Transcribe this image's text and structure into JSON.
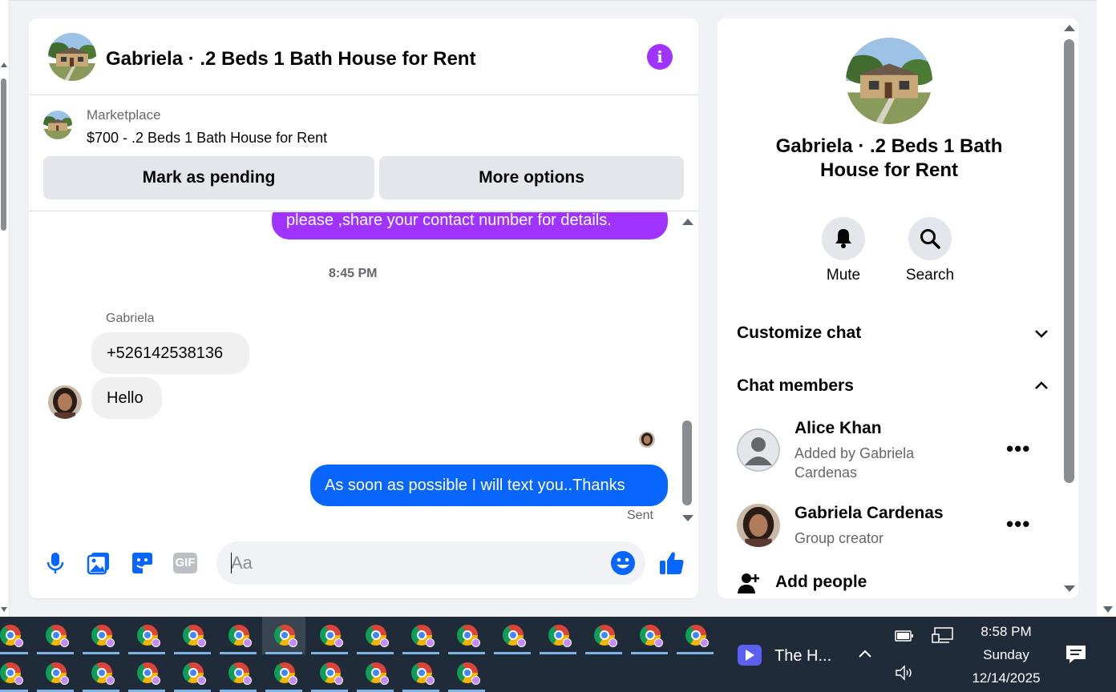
{
  "chat": {
    "title": "Gabriela · .2 Beds 1 Bath House for Rent",
    "info_icon": "info-icon",
    "marketplace": {
      "label": "Marketplace",
      "item": "$700 - .2 Beds 1 Bath House for Rent",
      "mark_pending": "Mark as pending",
      "more_options": "More options"
    },
    "messages": {
      "outgoing_top": "please ,share your contact  number for details.",
      "timestamp": "8:45 PM",
      "sender": "Gabriela",
      "incoming_1": "+526142538136",
      "incoming_2": "Hello",
      "outgoing_last": "As soon as possible I will text you..Thanks",
      "status": "Sent"
    },
    "composer": {
      "placeholder": "Aa",
      "icons": [
        "microphone-icon",
        "gallery-icon",
        "sticker-icon",
        "gif-icon",
        "emoji-icon",
        "like-icon"
      ],
      "gif_text": "GIF"
    }
  },
  "side": {
    "title": "Gabriela · .2 Beds 1 Bath House for Rent",
    "mute": "Mute",
    "search": "Search",
    "customize": "Customize chat",
    "members_header": "Chat members",
    "members": [
      {
        "name": "Alice Khan",
        "sub": "Added by Gabriela Cardenas"
      },
      {
        "name": "Gabriela Cardenas",
        "sub": "Group creator"
      }
    ],
    "more": "•••",
    "add_people": "Add people"
  },
  "taskbar": {
    "zoom_label": "The H...",
    "time": "8:58 PM",
    "day": "Sunday",
    "date": "12/14/2025"
  },
  "colors": {
    "purple": "#a033ff",
    "blue": "#0866ff",
    "taskbar": "#202b39"
  }
}
